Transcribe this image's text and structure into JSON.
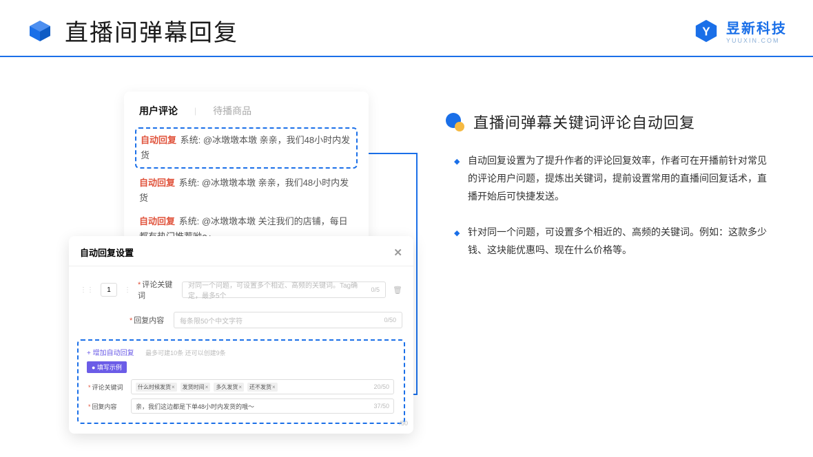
{
  "header": {
    "title": "直播间弹幕回复",
    "brand_name": "昱新科技",
    "brand_domain": "YUUXIN.COM"
  },
  "tabs": {
    "active": "用户评论",
    "inactive": "待播商品"
  },
  "comments": {
    "auto_reply_label": "自动回复",
    "c1": "系统: @冰墩墩本墩 亲亲，我们48小时内发货",
    "c2": "系统: @冰墩墩本墩 亲亲，我们48小时内发货",
    "c3": "系统: @冰墩墩本墩 关注我们的店铺，每日都有热门推荐呦～"
  },
  "settings": {
    "dialog_title": "自动回复设置",
    "seq": "1",
    "keyword_label": "评论关键词",
    "keyword_placeholder": "对同一个问题，可设置多个相近、高频的关键词。Tag确定，最多5个",
    "keyword_counter": "0/5",
    "content_label": "回复内容",
    "content_placeholder": "每条限50个中文字符",
    "content_counter": "0/50",
    "add_link": "+ 增加自动回复",
    "add_hint": "最多可建10条 还可以创建9条",
    "example_badge": "● 填写示例",
    "ex_keyword_label": "评论关键词",
    "ex_tags": [
      "什么时候发货",
      "发货时间",
      "多久发货",
      "还不发货"
    ],
    "ex_keyword_counter": "20/50",
    "ex_content_label": "回复内容",
    "ex_content_value": "亲，我们这边都是下单48小时内发货的哦～",
    "ex_content_counter": "37/50",
    "bottom_counter": "/50"
  },
  "right": {
    "section_title": "直播间弹幕关键词评论自动回复",
    "bullet1": "自动回复设置为了提升作者的评论回复效率，作者可在开播前针对常见的评论用户问题，提炼出关键词，提前设置常用的直播间回复话术，直播开始后可快捷发送。",
    "bullet2": "针对同一个问题，可设置多个相近的、高频的关键词。例如：这款多少钱、这块能优惠吗、现在什么价格等。"
  }
}
